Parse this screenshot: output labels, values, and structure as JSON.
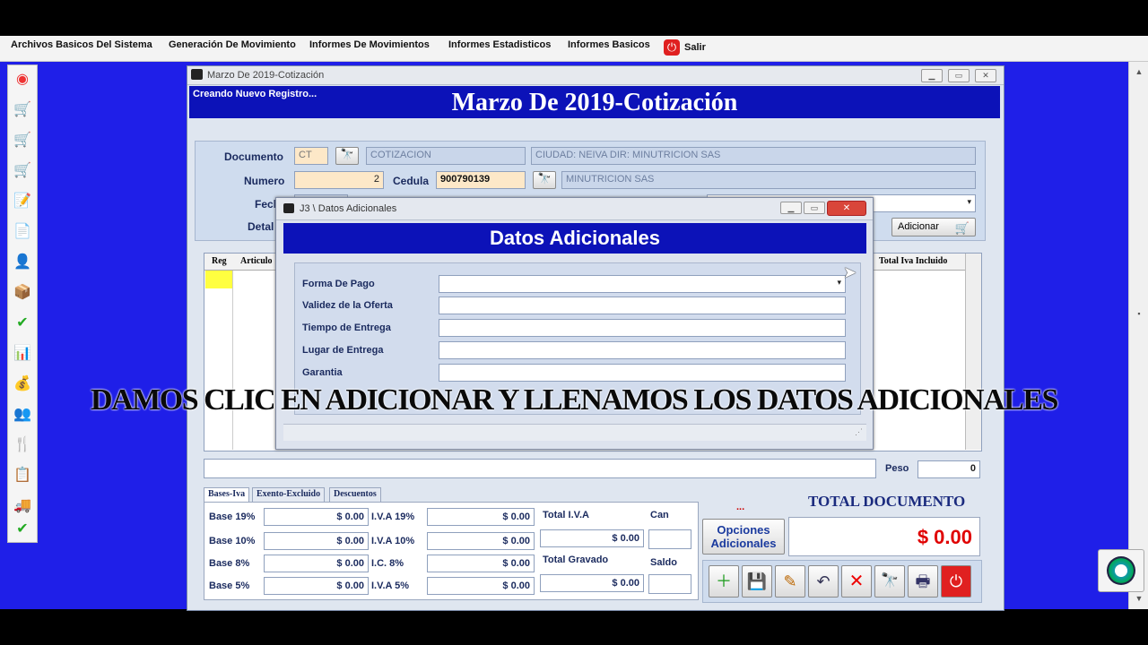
{
  "menubar": {
    "items": [
      "Archivos Basicos Del Sistema",
      "Generación De Movimiento",
      "Informes De Movimientos",
      "Informes Estadisticos",
      "Informes Basicos"
    ],
    "exit_label": "Salir"
  },
  "main_window": {
    "title": "Marzo De 2019-Cotización",
    "status": "Creando Nuevo Registro...",
    "banner": "Marzo De 2019-Cotización"
  },
  "form": {
    "documento_label": "Documento",
    "documento_code": "CT",
    "documento_name": "COTIZACION",
    "ciudad_info": "CIUDAD: NEIVA DIR: MINUTRICION SAS",
    "numero_label": "Numero",
    "numero_value": "2",
    "cedula_label": "Cedula",
    "cedula_value": "900790139",
    "client_name": "MINUTRICION SAS",
    "fecha_label_partial": "Fech",
    "detalle_label_partial": "Detal",
    "adicionar_label": "Adicionar"
  },
  "grid": {
    "col_reg": "Reg",
    "col_articulo": "Articulo",
    "col_total": "Total Iva Incluido"
  },
  "peso": {
    "label": "Peso",
    "value": "0"
  },
  "tabs": [
    "Bases-Iva",
    "Exento-Excluido",
    "Descuentos"
  ],
  "bases": [
    {
      "label": "Base 19%",
      "value": "$ 0.00",
      "iva_label": "I.V.A 19%",
      "iva_value": "$ 0.00"
    },
    {
      "label": "Base 10%",
      "value": "$ 0.00",
      "iva_label": "I.V.A 10%",
      "iva_value": "$ 0.00"
    },
    {
      "label": "Base 8%",
      "value": "$ 0.00",
      "iva_label": "I.C. 8%",
      "iva_value": "$ 0.00"
    },
    {
      "label": "Base 5%",
      "value": "$ 0.00",
      "iva_label": "I.V.A 5%",
      "iva_value": "$ 0.00"
    }
  ],
  "totals": {
    "total_iva_label": "Total I.V.A",
    "total_iva_value": "$ 0.00",
    "total_gravado_label": "Total Gravado",
    "total_gravado_value": "$ 0.00",
    "can_label": "Can",
    "saldo_label": "Saldo",
    "dots": "...",
    "total_documento_label": "TOTAL DOCUMENTO",
    "total_documento_value": "$ 0.00",
    "opciones_label_1": "Opciones",
    "opciones_label_2": "Adicionales"
  },
  "toolbar_icons": [
    "new-icon",
    "save-icon",
    "modify-icon",
    "undo-icon",
    "delete-icon",
    "search-binoculars-icon",
    "print-icon",
    "power-icon"
  ],
  "dialog": {
    "title": "J3 \\ Datos Adicionales",
    "banner": "Datos Adicionales",
    "fields": [
      {
        "label": "Forma De Pago",
        "value": ""
      },
      {
        "label": "Validez de la Oferta",
        "value": ""
      },
      {
        "label": "Tiempo de Entrega",
        "value": ""
      },
      {
        "label": "Lugar de Entrega",
        "value": ""
      },
      {
        "label": "Garantia",
        "value": ""
      }
    ]
  },
  "caption": "DAMOS CLIC EN ADICIONAR Y LLENAMOS LOS DATOS ADICIONALES",
  "colors": {
    "desktop": "#1f1fe8",
    "banner": "#0c12b8",
    "total_red": "#e00000"
  }
}
